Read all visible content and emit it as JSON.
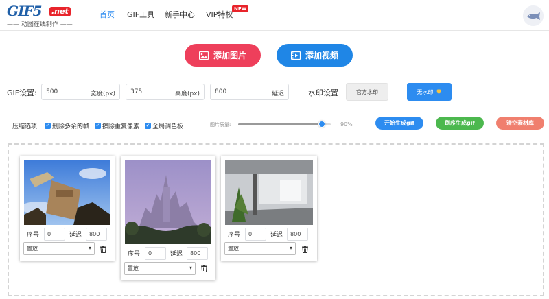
{
  "logo": {
    "main": "GIF5",
    "net": ".net",
    "tagline": "—— 动图在线制作 ——"
  },
  "nav": {
    "items": [
      "首页",
      "GIF工具",
      "新手中心",
      "VIP特权"
    ],
    "new_badge": "NEW"
  },
  "actions": {
    "add_image": "添加图片",
    "add_video": "添加视频"
  },
  "gif_settings": {
    "label": "GIF设置:",
    "width": {
      "value": "500",
      "unit": "宽度(px)"
    },
    "height": {
      "value": "375",
      "unit": "高度(px)"
    },
    "delay": {
      "value": "800",
      "unit": "延迟"
    }
  },
  "watermark": {
    "label": "水印设置",
    "official": "官方水印",
    "none": "无水印"
  },
  "compress": {
    "label": "压缩选项:",
    "options": [
      "删除多余的帧",
      "擦除重复像素",
      "全局调色板"
    ],
    "quality_label": "图片质量:",
    "quality_value": "90%",
    "quality_fraction": 0.9
  },
  "buttons": {
    "start": "开始生成gif",
    "reverse": "倒序生成gif",
    "clear": "清空素材库"
  },
  "colors": {
    "accent": "#2d8cf0",
    "red": "#ee3f5b",
    "green": "#4cb84e",
    "salmon": "#f07f6e"
  },
  "frames": [
    {
      "seq_label": "序号",
      "seq": "0",
      "delay_label": "延迟",
      "delay": "800",
      "mode": "置放"
    },
    {
      "seq_label": "序号",
      "seq": "0",
      "delay_label": "延迟",
      "delay": "800",
      "mode": "置放"
    },
    {
      "seq_label": "序号",
      "seq": "0",
      "delay_label": "延迟",
      "delay": "800",
      "mode": "置放"
    }
  ]
}
